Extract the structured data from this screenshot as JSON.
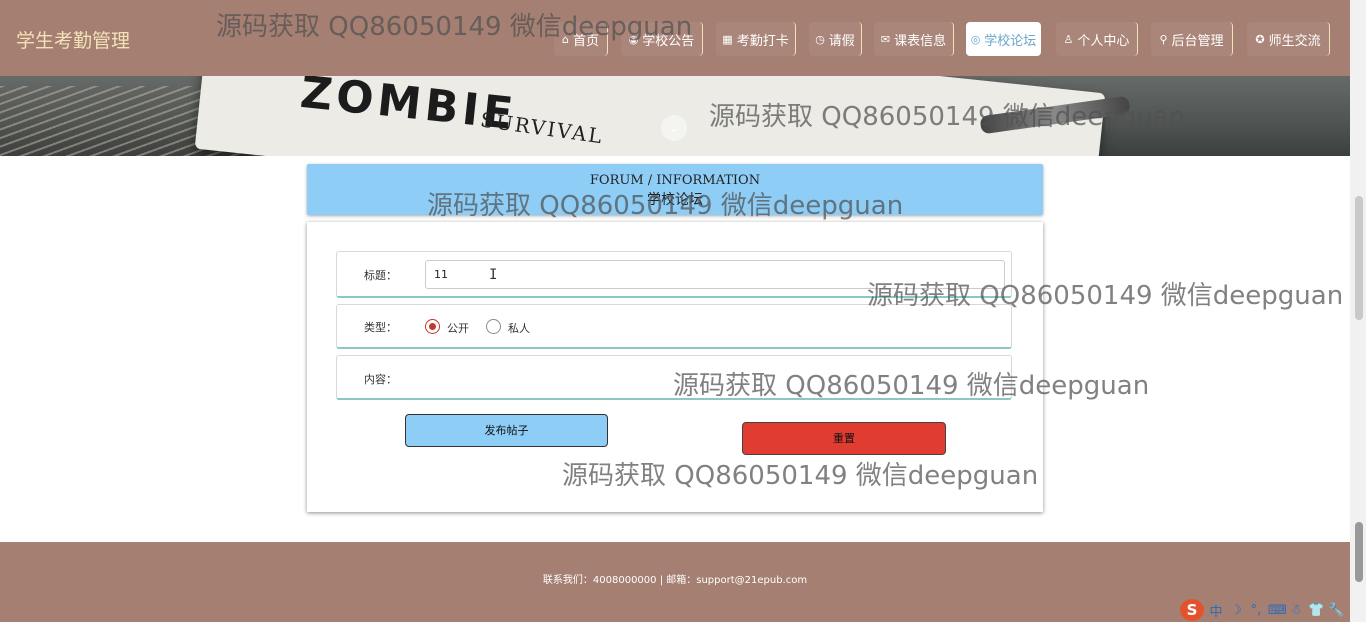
{
  "header": {
    "brand": "学生考勤管理",
    "nav": [
      {
        "icon": "⌂",
        "label": "首页",
        "active": false
      },
      {
        "icon": "◉",
        "label": "学校公告",
        "active": false
      },
      {
        "icon": "▦",
        "label": "考勤打卡",
        "active": false
      },
      {
        "icon": "◷",
        "label": "请假",
        "active": false
      },
      {
        "icon": "✉",
        "label": "课表信息",
        "active": false
      },
      {
        "icon": "◎",
        "label": "学校论坛",
        "active": true
      },
      {
        "icon": "♙",
        "label": "个人中心",
        "active": false
      },
      {
        "icon": "⚲",
        "label": "后台管理",
        "active": false
      },
      {
        "icon": "✪",
        "label": "师生交流",
        "active": false
      }
    ]
  },
  "banner": {
    "book_title": "ZOMBIE",
    "book_subtitle": "SURVIVAL",
    "scroll_icon": "chevron-down-icon"
  },
  "forum": {
    "title_en": "FORUM / INFORMATION",
    "title_zh": "学校论坛"
  },
  "form": {
    "title_label": "标题：",
    "title_value": "11",
    "type_label": "类型：",
    "type_options": [
      "公开",
      "私人"
    ],
    "type_selected": "公开",
    "content_label": "内容：",
    "publish_button": "发布帖子",
    "reset_button": "重置"
  },
  "footer": {
    "text": "联系我们：4008000000 | 邮箱：support@21epub.com"
  },
  "ime": {
    "logo": "S",
    "items": [
      "中",
      "☽",
      "°,",
      "⌨",
      "☃",
      "👕",
      "🔧"
    ]
  },
  "watermark": "源码获取 QQ86050149 微信deepguan",
  "colors": {
    "header_bg": "#a57f72",
    "brand_text": "#f3e2b8",
    "forum_header_bg": "#8ecdf6",
    "publish_bg": "#8ecdf6",
    "reset_bg": "#e03c31",
    "active_nav_text": "#6aa7c9"
  }
}
